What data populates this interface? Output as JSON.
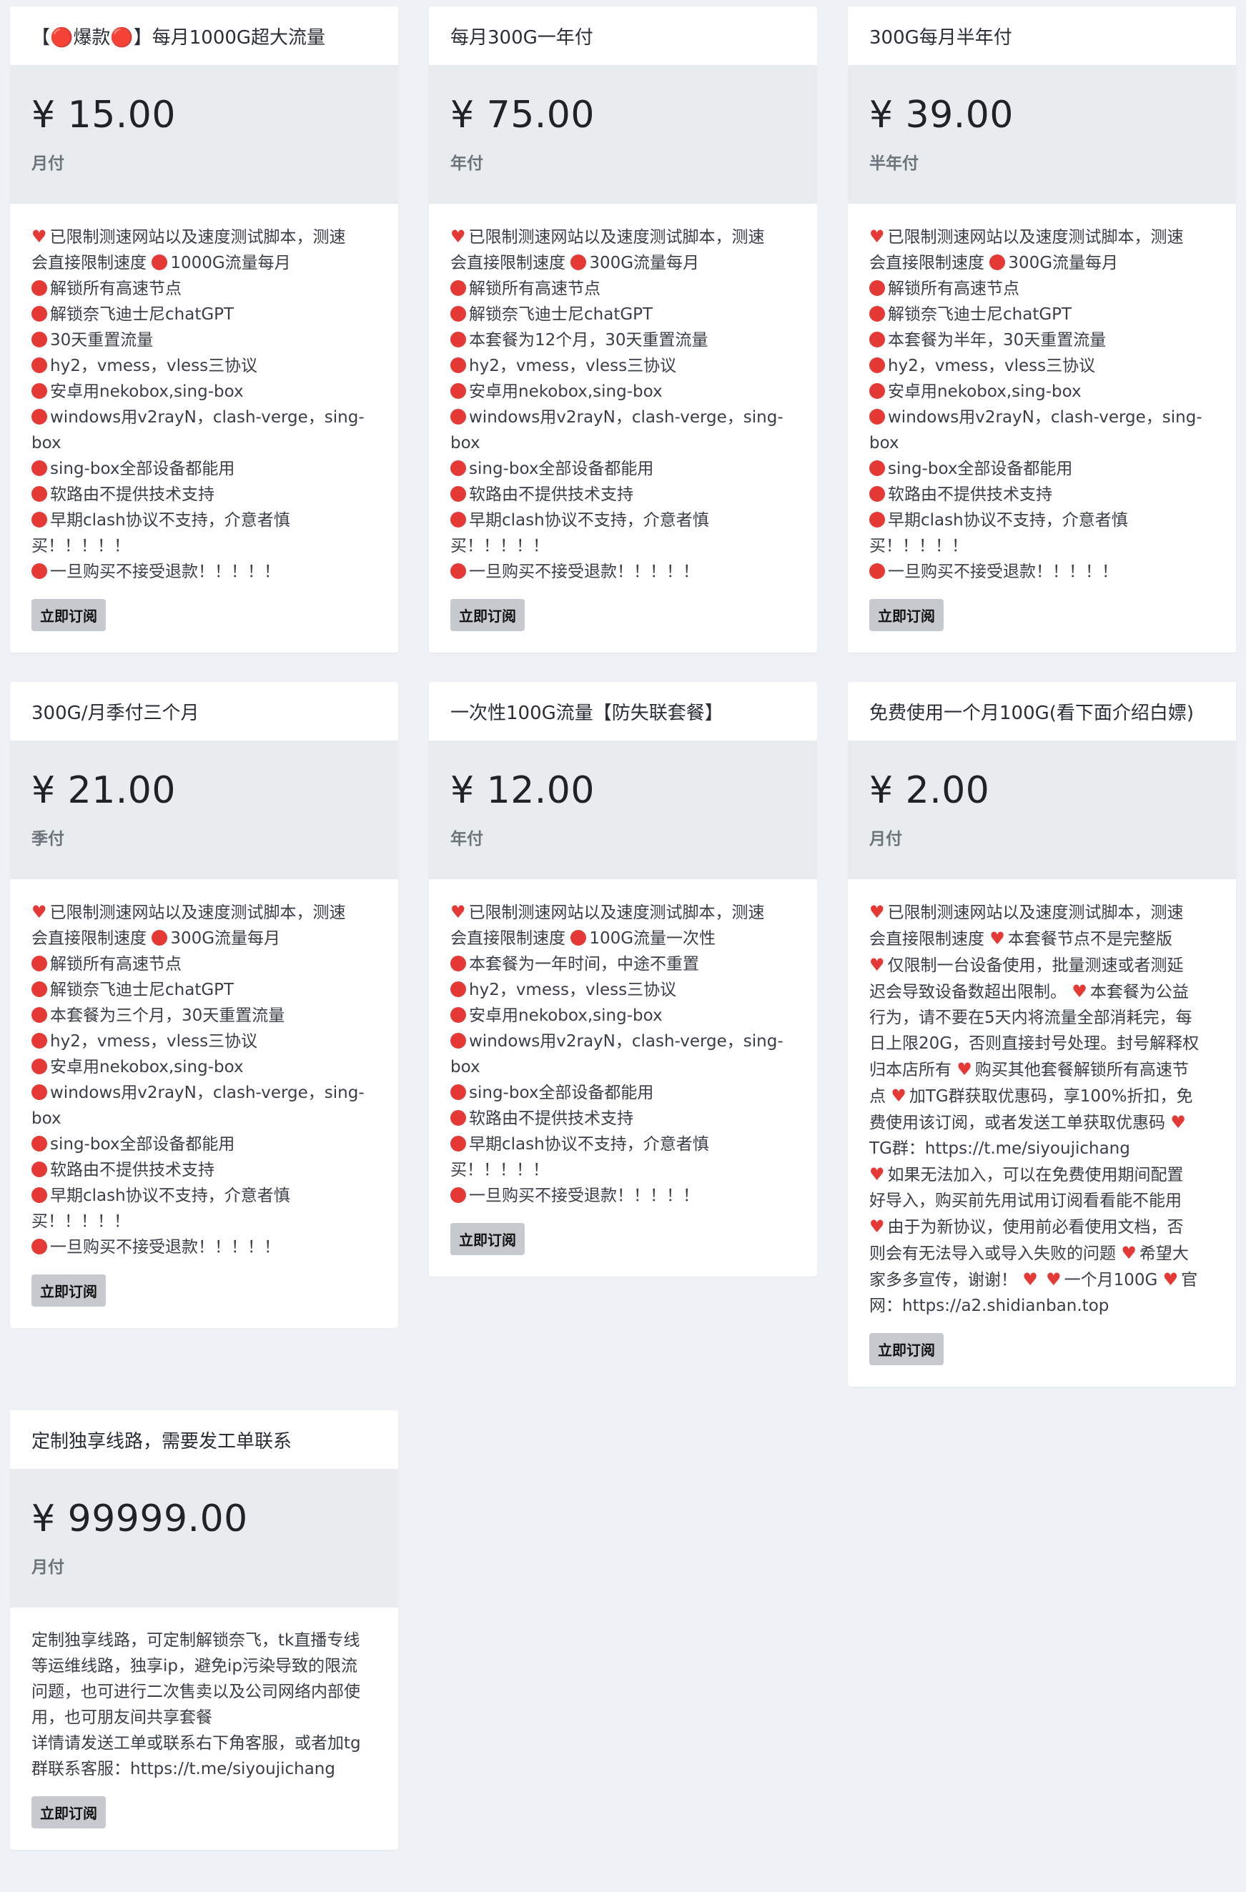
{
  "plans": [
    {
      "title": "【🔴爆款🔴】每月1000G超大流量",
      "price": "¥ 15.00",
      "period": "月付",
      "lines": [
        "❤️已限制测速网站以及速度测试脚本，测速",
        "会直接限制速度 🔴1000G流量每月",
        "🔴解锁所有高速节点",
        "🔴解锁奈飞迪士尼chatGPT",
        "🔴30天重置流量",
        "🔴hy2，vmess，vless三协议",
        "🔴安卓用nekobox,sing-box",
        "🔴windows用v2rayN，clash-verge，sing-",
        "box",
        "🔴sing-box全部设备都能用",
        "🔴软路由不提供技术支持",
        "🔴早期clash协议不支持，介意者慎",
        "买！！！！！",
        "🔴一旦购买不接受退款！！！！！"
      ],
      "button": "立即订阅"
    },
    {
      "title": "每月300G一年付",
      "price": "¥ 75.00",
      "period": "年付",
      "lines": [
        "❤️已限制测速网站以及速度测试脚本，测速",
        "会直接限制速度 🔴300G流量每月",
        "🔴解锁所有高速节点",
        "🔴解锁奈飞迪士尼chatGPT",
        "🔴本套餐为12个月，30天重置流量",
        "🔴hy2，vmess，vless三协议",
        "🔴安卓用nekobox,sing-box",
        "🔴windows用v2rayN，clash-verge，sing-",
        "box",
        "🔴sing-box全部设备都能用",
        "🔴软路由不提供技术支持",
        "🔴早期clash协议不支持，介意者慎",
        "买！！！！！",
        "🔴一旦购买不接受退款！！！！！"
      ],
      "button": "立即订阅"
    },
    {
      "title": "300G每月半年付",
      "price": "¥ 39.00",
      "period": "半年付",
      "lines": [
        "❤️已限制测速网站以及速度测试脚本，测速",
        "会直接限制速度 🔴300G流量每月",
        "🔴解锁所有高速节点",
        "🔴解锁奈飞迪士尼chatGPT",
        "🔴本套餐为半年，30天重置流量",
        "🔴hy2，vmess，vless三协议",
        "🔴安卓用nekobox,sing-box",
        "🔴windows用v2rayN，clash-verge，sing-",
        "box",
        "🔴sing-box全部设备都能用",
        "🔴软路由不提供技术支持",
        "🔴早期clash协议不支持，介意者慎",
        "买！！！！！",
        "🔴一旦购买不接受退款！！！！！"
      ],
      "button": "立即订阅"
    },
    {
      "title": "300G/月季付三个月",
      "price": "¥ 21.00",
      "period": "季付",
      "lines": [
        "❤️已限制测速网站以及速度测试脚本，测速",
        "会直接限制速度 🔴300G流量每月",
        "🔴解锁所有高速节点",
        "🔴解锁奈飞迪士尼chatGPT",
        "🔴本套餐为三个月，30天重置流量",
        "🔴hy2，vmess，vless三协议",
        "🔴安卓用nekobox,sing-box",
        "🔴windows用v2rayN，clash-verge，sing-",
        "box",
        "🔴sing-box全部设备都能用",
        "🔴软路由不提供技术支持",
        "🔴早期clash协议不支持，介意者慎",
        "买！！！！！",
        "🔴一旦购买不接受退款！！！！！"
      ],
      "button": "立即订阅"
    },
    {
      "title": "一次性100G流量【防失联套餐】",
      "price": "¥ 12.00",
      "period": "年付",
      "lines": [
        "❤️已限制测速网站以及速度测试脚本，测速",
        "会直接限制速度 🔴100G流量一次性",
        "🔴本套餐为一年时间，中途不重置",
        "🔴hy2，vmess，vless三协议",
        "🔴安卓用nekobox,sing-box",
        "🔴windows用v2rayN，clash-verge，sing-",
        "box",
        "🔴sing-box全部设备都能用",
        "🔴软路由不提供技术支持",
        "🔴早期clash协议不支持，介意者慎",
        "买！！！！！",
        "🔴一旦购买不接受退款！！！！！"
      ],
      "button": "立即订阅"
    },
    {
      "title": "免费使用一个月100G(看下面介绍白嫖)",
      "price": "¥ 2.00",
      "period": "月付",
      "lines": [
        "❤️已限制测速网站以及速度测试脚本，测速",
        "会直接限制速度 ❤️本套餐节点不是完整版",
        "❤️仅限制一台设备使用，批量测速或者测延",
        "迟会导致设备数超出限制。 ❤️本套餐为公益",
        "行为，请不要在5天内将流量全部消耗完，每",
        "日上限20G，否则直接封号处理。封号解释权",
        "归本店所有 ❤️购买其他套餐解锁所有高速节",
        "点 ❤️加TG群获取优惠码，享100%折扣，免",
        "费使用该订阅，或者发送工单获取优惠码 ❤️",
        "TG群：https://t.me/siyoujichang",
        "❤️如果无法加入，可以在免费使用期间配置",
        "好导入，购买前先用试用订阅看看能不能用",
        "❤️由于为新协议，使用前必看使用文档，否",
        "则会有无法导入或导入失败的问题 ❤️希望大",
        "家多多宣传，谢谢！ ❤️ ❤️一个月100G ❤️官",
        "网：https://a2.shidianban.top"
      ],
      "button": "立即订阅"
    },
    {
      "title": "定制独享线路，需要发工单联系",
      "price": "¥ 99999.00",
      "period": "月付",
      "lines": [
        "定制独享线路，可定制解锁奈飞，tk直播专线",
        "等运维线路，独享ip，避免ip污染导致的限流",
        "问题，也可进行二次售卖以及公司网络内部使",
        "用，也可朋友间共享套餐",
        "详情请发送工单或联系右下角客服，或者加tg",
        "群联系客服：https://t.me/siyoujichang"
      ],
      "button": "立即订阅"
    }
  ]
}
